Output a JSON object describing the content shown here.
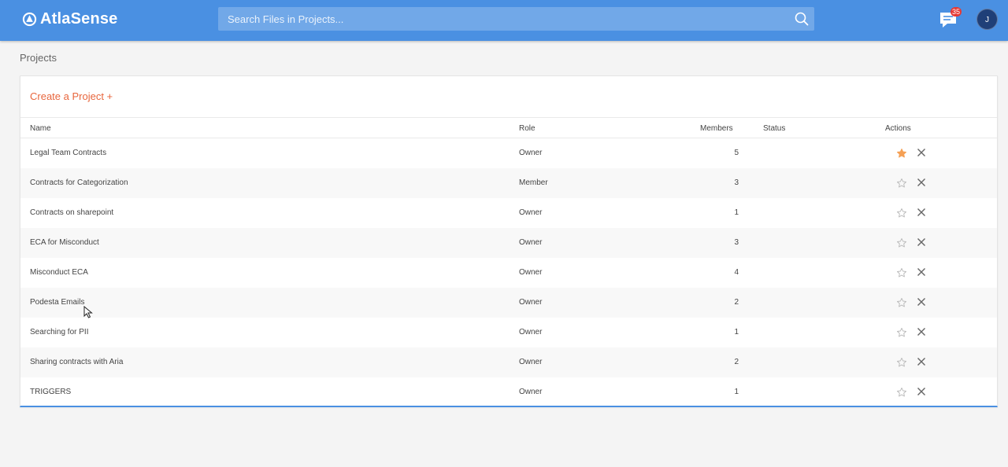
{
  "app": {
    "logo_text": "AtlaSense"
  },
  "search": {
    "placeholder": "Search Files in Projects..."
  },
  "notifications": {
    "count": "35"
  },
  "user": {
    "avatar_initial": "J"
  },
  "page": {
    "title": "Projects",
    "create_label": "Create a Project +"
  },
  "table": {
    "headers": {
      "name": "Name",
      "role": "Role",
      "members": "Members",
      "status": "Status",
      "actions": "Actions"
    },
    "rows": [
      {
        "name": "Legal Team Contracts",
        "role": "Owner",
        "members": "5",
        "status": "",
        "starred": true
      },
      {
        "name": "Contracts for Categorization",
        "role": "Member",
        "members": "3",
        "status": "",
        "starred": false
      },
      {
        "name": "Contracts on sharepoint",
        "role": "Owner",
        "members": "1",
        "status": "",
        "starred": false
      },
      {
        "name": "ECA for Misconduct",
        "role": "Owner",
        "members": "3",
        "status": "",
        "starred": false
      },
      {
        "name": "Misconduct ECA",
        "role": "Owner",
        "members": "4",
        "status": "",
        "starred": false
      },
      {
        "name": "Podesta Emails",
        "role": "Owner",
        "members": "2",
        "status": "",
        "starred": false
      },
      {
        "name": "Searching for PII",
        "role": "Owner",
        "members": "1",
        "status": "",
        "starred": false
      },
      {
        "name": "Sharing contracts with Aria",
        "role": "Owner",
        "members": "2",
        "status": "",
        "starred": false
      },
      {
        "name": "TRIGGERS",
        "role": "Owner",
        "members": "1",
        "status": "",
        "starred": false
      }
    ]
  },
  "colors": {
    "header_bg": "#4a90e2",
    "accent": "#e8663d",
    "star_active": "#f5a055",
    "star_inactive": "#bbbbbb",
    "badge": "#e53935"
  },
  "icons": {
    "logo": "atlas-logo-icon",
    "search": "search-icon",
    "chat": "chat-icon",
    "star": "star-icon",
    "close": "close-icon"
  }
}
